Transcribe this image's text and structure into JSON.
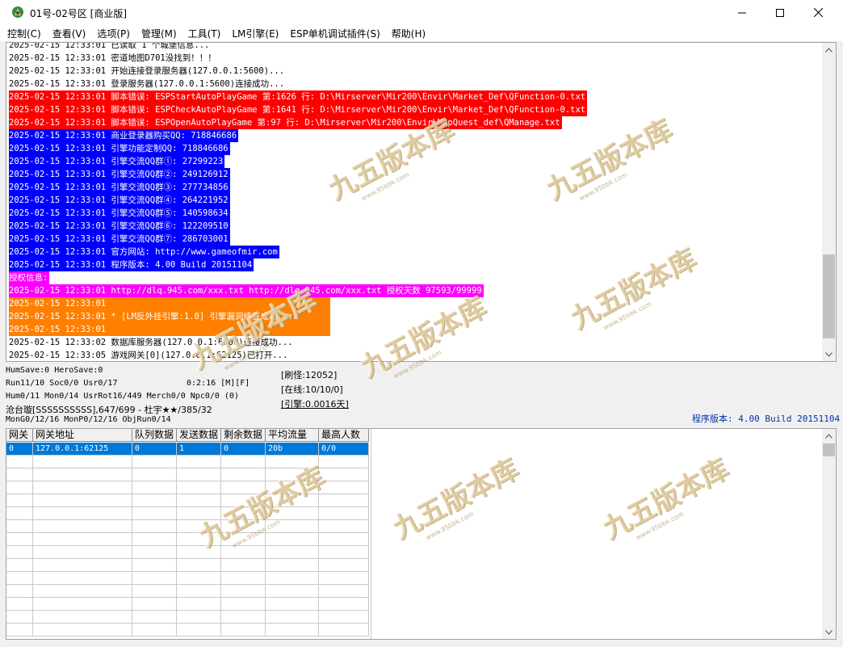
{
  "window": {
    "title": "01号-02号区 [商业版]"
  },
  "menu": [
    "控制(C)",
    "查看(V)",
    "选项(P)",
    "管理(M)",
    "工具(T)",
    "LM引擎(E)",
    "ESP单机调试插件(S)",
    "帮助(H)"
  ],
  "log_lines": [
    {
      "text": "2025-02-15 12:33:01 已读取 1 个城堡信息...",
      "style": "normal"
    },
    {
      "text": "2025-02-15 12:33:01 密道地图D701没找到！！！",
      "style": "normal"
    },
    {
      "text": "2025-02-15 12:33:01 开始连接登录服务器(127.0.0.1:5600)...",
      "style": "normal"
    },
    {
      "text": "2025-02-15 12:33:01 登录服务器(127.0.0.1:5600)连接成功...",
      "style": "normal"
    },
    {
      "text": "2025-02-15 12:33:01 脚本错误: ESPStartAutoPlayGame 第:1626 行: D:\\Mirserver\\Mir200\\Envir\\Market_Def\\QFunction-0.txt",
      "style": "red"
    },
    {
      "text": "2025-02-15 12:33:01 脚本错误: ESPCheckAutoPlayGame 第:1641 行: D:\\Mirserver\\Mir200\\Envir\\Market_Def\\QFunction-0.txt",
      "style": "red"
    },
    {
      "text": "2025-02-15 12:33:01 脚本错误: ESPOpenAutoPlayGame 第:97 行: D:\\Mirserver\\Mir200\\Envir\\MapQuest_def\\QManage.txt",
      "style": "red"
    },
    {
      "text": "2025-02-15 12:33:01 商业登录器购买QQ: 718846686",
      "style": "blue"
    },
    {
      "text": "2025-02-15 12:33:01 引擎功能定制QQ: 718846686",
      "style": "blue"
    },
    {
      "text": "2025-02-15 12:33:01 引擎交流QQ群①: 27299223",
      "style": "blue"
    },
    {
      "text": "2025-02-15 12:33:01 引擎交流QQ群②: 249126912",
      "style": "blue"
    },
    {
      "text": "2025-02-15 12:33:01 引擎交流QQ群③: 277734856",
      "style": "blue"
    },
    {
      "text": "2025-02-15 12:33:01 引擎交流QQ群④: 264221952",
      "style": "blue"
    },
    {
      "text": "2025-02-15 12:33:01 引擎交流QQ群⑤: 140598634",
      "style": "blue"
    },
    {
      "text": "2025-02-15 12:33:01 引擎交流QQ群⑥: 122209510",
      "style": "blue"
    },
    {
      "text": "2025-02-15 12:33:01 引擎交流QQ群⑦: 286703001",
      "style": "blue"
    },
    {
      "text": "2025-02-15 12:33:01 官方网站: http://www.gameofmir.com",
      "style": "blue"
    },
    {
      "text": "2025-02-15 12:33:01 程序版本: 4.00 Build 20151104",
      "style": "blue"
    },
    {
      "text": "授权信息:",
      "style": "magenta"
    },
    {
      "text": "2025-02-15 12:33:01 http://dlq.945.com/xxx.txt http://dlq.945.com/xxx.txt 授权天数 97593/99999",
      "style": "magenta"
    },
    {
      "text": "2025-02-15 12:33:01 ",
      "style": "orange-block"
    },
    {
      "text": "2025-02-15 12:33:01 * [LM反外挂引擎:1.0] 引擎漏洞修复成功...",
      "style": "orange-block"
    },
    {
      "text": "2025-02-15 12:33:01 ",
      "style": "orange-block"
    },
    {
      "text": "2025-02-15 12:33:02 数据库服务器(127.0.0.1:6000)连接成功...",
      "style": "normal"
    },
    {
      "text": "2025-02-15 12:33:05 游戏网关[0](127.0.0.1:62125)已打开...",
      "style": "normal"
    }
  ],
  "status": {
    "line1": "HumSave:0 HeroSave:0",
    "line2": "Run11/10 Soc0/0 Usr0/17",
    "line2b": "0:2:16 [M][F]",
    "line3": "Hum0/11 Mon0/14 UsrRot16/449 Merch0/0 Npc0/0 (0)",
    "line4": "沧台璇[SSSSSSSSSS],647/699 - 杜宇★★/385/32",
    "line5": "MonG0/12/16 MonP0/12/16 ObjRun0/14",
    "refresh": "[刷怪:12052]",
    "online": "[在线:10/10/0]",
    "engine": "[引擎:0.0016天]",
    "version": "程序版本: 4.00 Build 20151104"
  },
  "grid": {
    "headers": [
      "网关",
      "网关地址",
      "队列数据",
      "发送数据",
      "剩余数据",
      "平均流量",
      "最高人数"
    ],
    "rows": [
      [
        "0",
        "127.0.0.1:62125",
        "0",
        "1",
        "0",
        "20b",
        "0/0"
      ]
    ]
  },
  "watermark": {
    "text": "九五版本库",
    "sub": "www.95bbk.com"
  }
}
